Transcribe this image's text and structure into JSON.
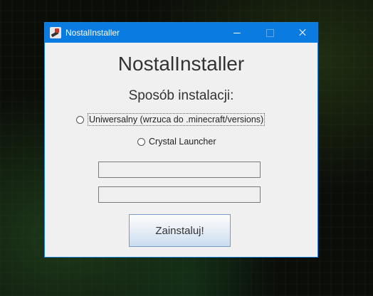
{
  "window": {
    "title": "NostalInstaller",
    "controls": {
      "minimize": "minimize-icon",
      "maximize": "maximize-icon",
      "close": "close-icon"
    }
  },
  "main": {
    "heading": "NostalInstaller",
    "install_method_label": "Sposób instalacji:",
    "options": [
      {
        "label": "Uniwersalny (wrzuca do .minecraft/versions)",
        "selected": false,
        "focused": true
      },
      {
        "label": "Crystal Launcher",
        "selected": false,
        "focused": false
      }
    ],
    "fields": [
      {
        "value": "",
        "placeholder": ""
      },
      {
        "value": "",
        "placeholder": ""
      }
    ],
    "install_button_label": "Zainstaluj!"
  },
  "colors": {
    "titlebar": "#0a7be0",
    "window_bg": "#f0f0f0"
  }
}
